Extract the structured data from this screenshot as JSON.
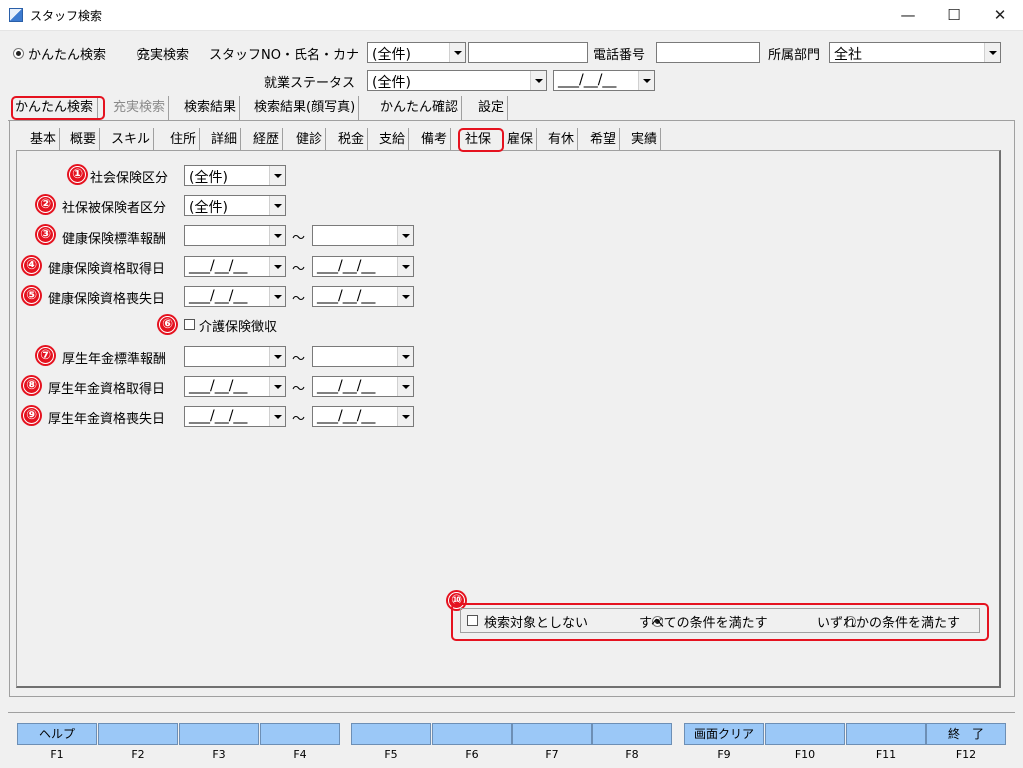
{
  "window": {
    "title": "スタッフ検索",
    "minimize": "—",
    "maximize": "☐",
    "close": "✕"
  },
  "search": {
    "mode_simple": "かんたん検索",
    "mode_full": "充実検索",
    "staff_label": "スタッフNO・氏名・カナ",
    "staff_select": "(全件)",
    "staff_text": "",
    "phone_label": "電話番号",
    "phone_value": "",
    "dept_label": "所属部門",
    "dept_value": "全社",
    "status_label": "就業ステータス",
    "status_value": "(全件)",
    "date_value": "___/__/__"
  },
  "main_tabs": [
    "かんたん検索",
    "充実検索",
    "検索結果",
    "検索結果(顔写真)",
    "かんたん確認",
    "設定"
  ],
  "sub_tabs": [
    "基本",
    "概要",
    "スキル",
    "住所",
    "詳細",
    "経歴",
    "健診",
    "税金",
    "支給",
    "備考",
    "社保",
    "雇保",
    "有休",
    "希望",
    "実績"
  ],
  "form": {
    "row1": {
      "num": "①",
      "label": "社会保険区分",
      "value": "(全件)"
    },
    "row2": {
      "num": "②",
      "label": "社保被保険者区分",
      "value": "(全件)"
    },
    "row3": {
      "num": "③",
      "label": "健康保険標準報酬",
      "from": "",
      "to": ""
    },
    "row4": {
      "num": "④",
      "label": "健康保険資格取得日",
      "from": "___/__/__",
      "to": "___/__/__"
    },
    "row5": {
      "num": "⑤",
      "label": "健康保険資格喪失日",
      "from": "___/__/__",
      "to": "___/__/__"
    },
    "row6": {
      "num": "⑥",
      "label": "介護保険徴収"
    },
    "row7": {
      "num": "⑦",
      "label": "厚生年金標準報酬",
      "from": "",
      "to": ""
    },
    "row8": {
      "num": "⑧",
      "label": "厚生年金資格取得日",
      "from": "___/__/__",
      "to": "___/__/__"
    },
    "row9": {
      "num": "⑨",
      "label": "厚生年金資格喪失日",
      "from": "___/__/__",
      "to": "___/__/__"
    },
    "tilde": "～"
  },
  "conditions": {
    "num": "⑩",
    "exclude": "検索対象としない",
    "all": "すべての条件を満たす",
    "any": "いずれかの条件を満たす"
  },
  "fkeys": [
    {
      "label": "ヘルプ",
      "key": "F1"
    },
    {
      "label": "",
      "key": "F2"
    },
    {
      "label": "",
      "key": "F3"
    },
    {
      "label": "",
      "key": "F4"
    },
    {
      "label": "",
      "key": "F5"
    },
    {
      "label": "",
      "key": "F6"
    },
    {
      "label": "",
      "key": "F7"
    },
    {
      "label": "",
      "key": "F8"
    },
    {
      "label": "画面クリア",
      "key": "F9"
    },
    {
      "label": "",
      "key": "F10"
    },
    {
      "label": "",
      "key": "F11"
    },
    {
      "label": "終　了",
      "key": "F12"
    }
  ]
}
